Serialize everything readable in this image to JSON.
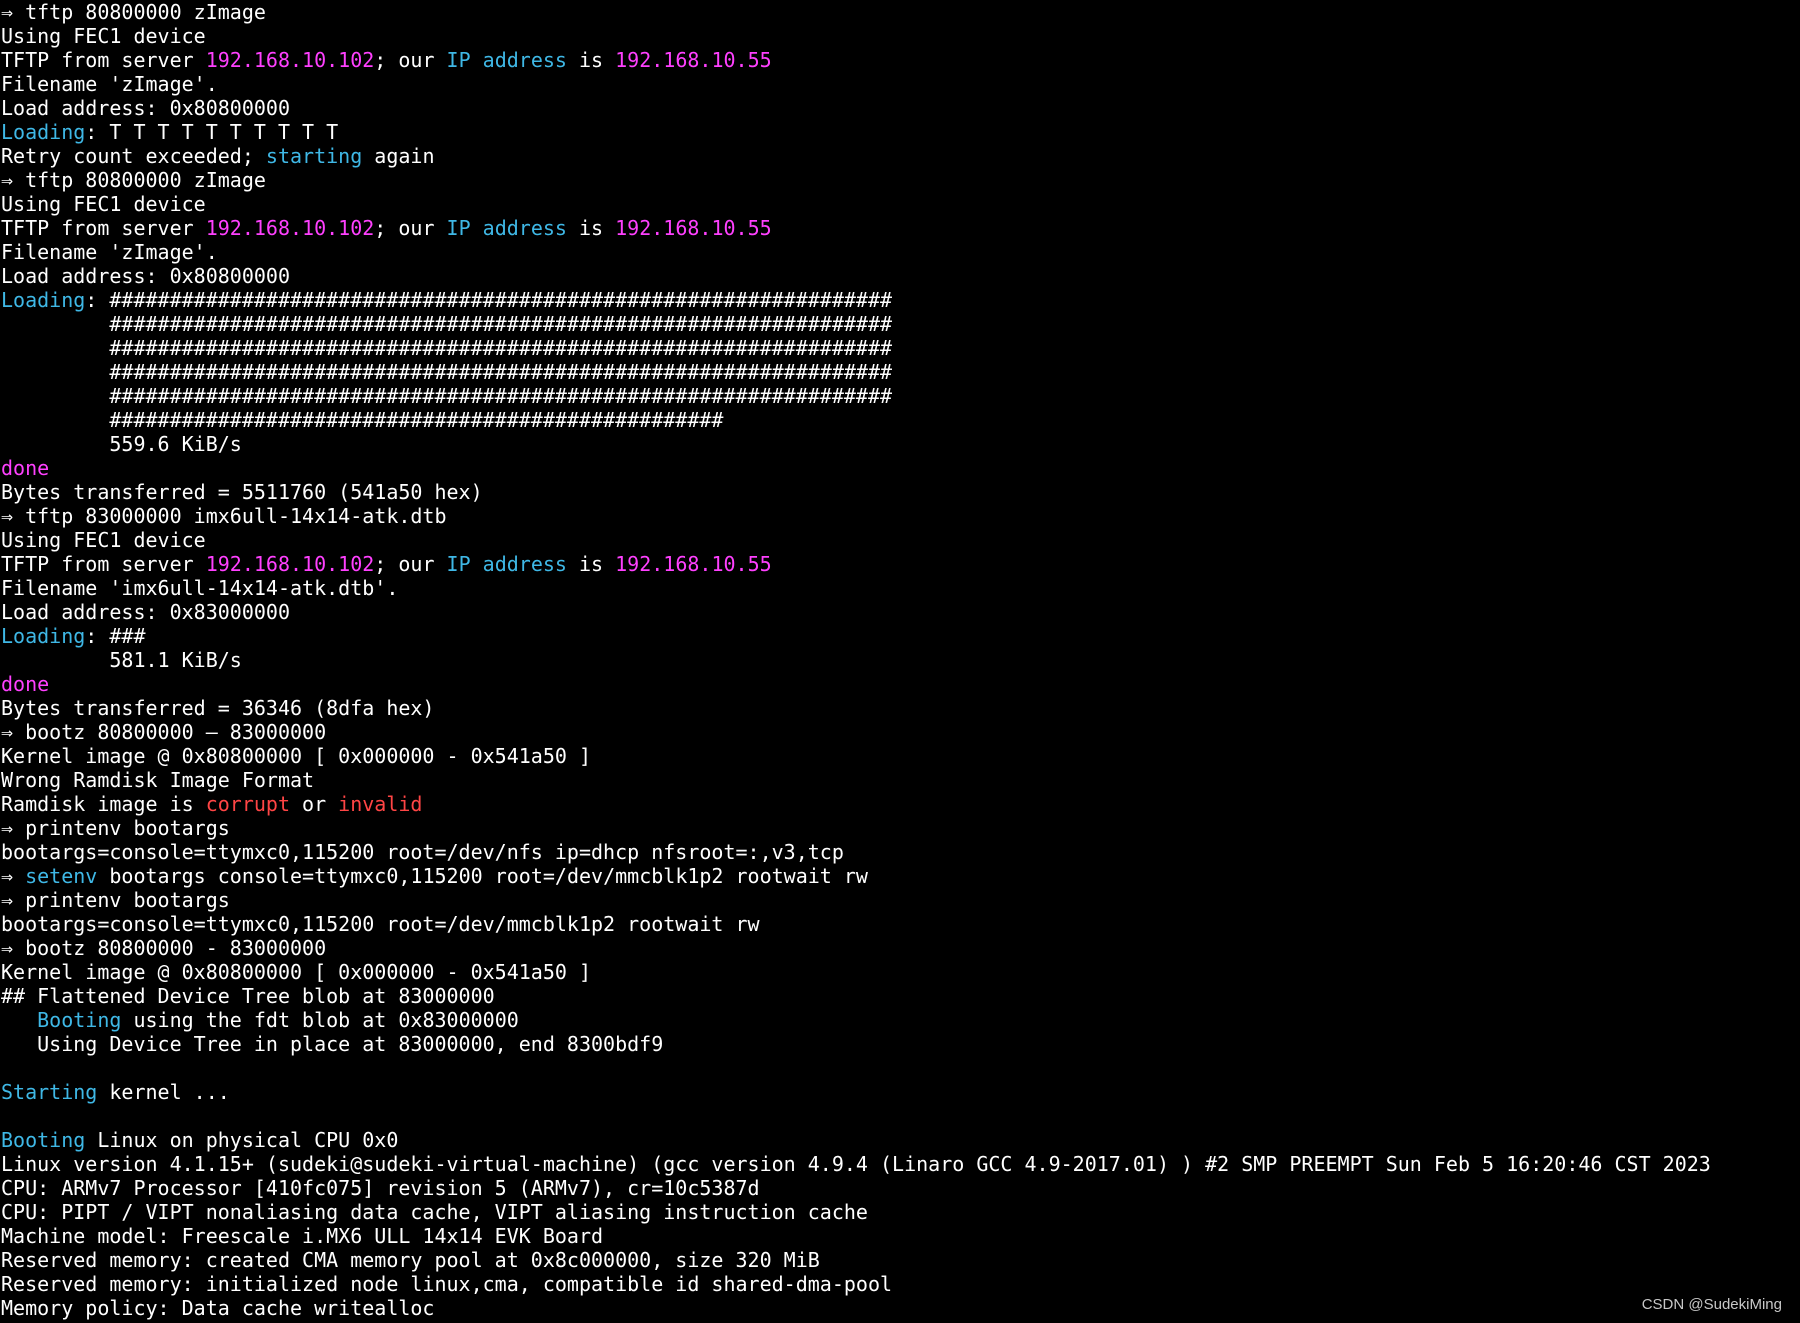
{
  "colors": {
    "background": "#000000",
    "text": "#ffffff",
    "cyan": "#3fb8e6",
    "magenta": "#ff40ff",
    "red": "#ff4545"
  },
  "terminal": {
    "lines": [
      [
        {
          "t": "⇒ tftp 80800000 zImage"
        }
      ],
      [
        {
          "t": "Using FEC1 device"
        }
      ],
      [
        {
          "t": "TFTP from server "
        },
        {
          "t": "192.168.10.102",
          "c": "magenta"
        },
        {
          "t": "; our "
        },
        {
          "t": "IP address",
          "c": "cyan"
        },
        {
          "t": " is "
        },
        {
          "t": "192.168.10.55",
          "c": "magenta"
        }
      ],
      [
        {
          "t": "Filename 'zImage'."
        }
      ],
      [
        {
          "t": "Load address: 0x80800000"
        }
      ],
      [
        {
          "t": "Loading",
          "c": "cyan"
        },
        {
          "t": ": T T T T T T T T T T"
        }
      ],
      [
        {
          "t": "Retry count exceeded; "
        },
        {
          "t": "starting",
          "c": "cyan"
        },
        {
          "t": " again"
        }
      ],
      [
        {
          "t": "⇒ tftp 80800000 zImage"
        }
      ],
      [
        {
          "t": "Using FEC1 device"
        }
      ],
      [
        {
          "t": "TFTP from server "
        },
        {
          "t": "192.168.10.102",
          "c": "magenta"
        },
        {
          "t": "; our "
        },
        {
          "t": "IP address",
          "c": "cyan"
        },
        {
          "t": " is "
        },
        {
          "t": "192.168.10.55",
          "c": "magenta"
        }
      ],
      [
        {
          "t": "Filename 'zImage'."
        }
      ],
      [
        {
          "t": "Load address: 0x80800000"
        }
      ],
      [
        {
          "t": "Loading",
          "c": "cyan"
        },
        {
          "t": ": #################################################################"
        }
      ],
      [
        {
          "t": "         #################################################################"
        }
      ],
      [
        {
          "t": "         #################################################################"
        }
      ],
      [
        {
          "t": "         #################################################################"
        }
      ],
      [
        {
          "t": "         #################################################################"
        }
      ],
      [
        {
          "t": "         ###################################################"
        }
      ],
      [
        {
          "t": "         559.6 KiB/s"
        }
      ],
      [
        {
          "t": "done",
          "c": "magenta"
        }
      ],
      [
        {
          "t": "Bytes transferred = 5511760 (541a50 hex)"
        }
      ],
      [
        {
          "t": "⇒ tftp 83000000 imx6ull-14x14-atk.dtb"
        }
      ],
      [
        {
          "t": "Using FEC1 device"
        }
      ],
      [
        {
          "t": "TFTP from server "
        },
        {
          "t": "192.168.10.102",
          "c": "magenta"
        },
        {
          "t": "; our "
        },
        {
          "t": "IP address",
          "c": "cyan"
        },
        {
          "t": " is "
        },
        {
          "t": "192.168.10.55",
          "c": "magenta"
        }
      ],
      [
        {
          "t": "Filename 'imx6ull-14x14-atk.dtb'."
        }
      ],
      [
        {
          "t": "Load address: 0x83000000"
        }
      ],
      [
        {
          "t": "Loading",
          "c": "cyan"
        },
        {
          "t": ": ###"
        }
      ],
      [
        {
          "t": "         581.1 KiB/s"
        }
      ],
      [
        {
          "t": "done",
          "c": "magenta"
        }
      ],
      [
        {
          "t": "Bytes transferred = 36346 (8dfa hex)"
        }
      ],
      [
        {
          "t": "⇒ bootz 80800000 – 83000000"
        }
      ],
      [
        {
          "t": "Kernel image @ 0x80800000 [ 0x000000 - 0x541a50 ]"
        }
      ],
      [
        {
          "t": "Wrong Ramdisk Image Format"
        }
      ],
      [
        {
          "t": "Ramdisk image is "
        },
        {
          "t": "corrupt",
          "c": "red"
        },
        {
          "t": " or "
        },
        {
          "t": "invalid",
          "c": "red"
        }
      ],
      [
        {
          "t": "⇒ printenv bootargs"
        }
      ],
      [
        {
          "t": "bootargs=console=ttymxc0,115200 root=/dev/nfs ip=dhcp nfsroot=:,v3,tcp"
        }
      ],
      [
        {
          "t": "⇒ "
        },
        {
          "t": "setenv",
          "c": "cyan"
        },
        {
          "t": " bootargs console=ttymxc0,115200 root=/dev/mmcblk1p2 rootwait rw"
        }
      ],
      [
        {
          "t": "⇒ printenv bootargs"
        }
      ],
      [
        {
          "t": "bootargs=console=ttymxc0,115200 root=/dev/mmcblk1p2 rootwait rw"
        }
      ],
      [
        {
          "t": "⇒ bootz 80800000 - 83000000"
        }
      ],
      [
        {
          "t": "Kernel image @ 0x80800000 [ 0x000000 - 0x541a50 ]"
        }
      ],
      [
        {
          "t": "## Flattened Device Tree blob at 83000000"
        }
      ],
      [
        {
          "t": "   "
        },
        {
          "t": "Booting",
          "c": "cyan"
        },
        {
          "t": " using the fdt blob at 0x83000000"
        }
      ],
      [
        {
          "t": "   Using Device Tree in place at 83000000, end 8300bdf9"
        }
      ],
      [],
      [
        {
          "t": "Starting",
          "c": "cyan"
        },
        {
          "t": " kernel ..."
        }
      ],
      [],
      [
        {
          "t": "Booting",
          "c": "cyan"
        },
        {
          "t": " Linux on physical CPU 0x0"
        }
      ],
      [
        {
          "t": "Linux version 4.1.15+ (sudeki@sudeki-virtual-machine) (gcc version 4.9.4 (Linaro GCC 4.9-2017.01) ) #2 SMP PREEMPT Sun Feb 5 16:20:46 CST 2023"
        }
      ],
      [
        {
          "t": "CPU: ARMv7 Processor [410fc075] revision 5 (ARMv7), cr=10c5387d"
        }
      ],
      [
        {
          "t": "CPU: PIPT / VIPT nonaliasing data cache, VIPT aliasing instruction cache"
        }
      ],
      [
        {
          "t": "Machine model: Freescale i.MX6 ULL 14x14 EVK Board"
        }
      ],
      [
        {
          "t": "Reserved memory: created CMA memory pool at 0x8c000000, size 320 MiB"
        }
      ],
      [
        {
          "t": "Reserved memory: initialized node linux,cma, compatible id shared-dma-pool"
        }
      ],
      [
        {
          "t": "Memory policy: Data cache writealloc"
        }
      ]
    ]
  },
  "watermark": "CSDN @SudekiMing"
}
